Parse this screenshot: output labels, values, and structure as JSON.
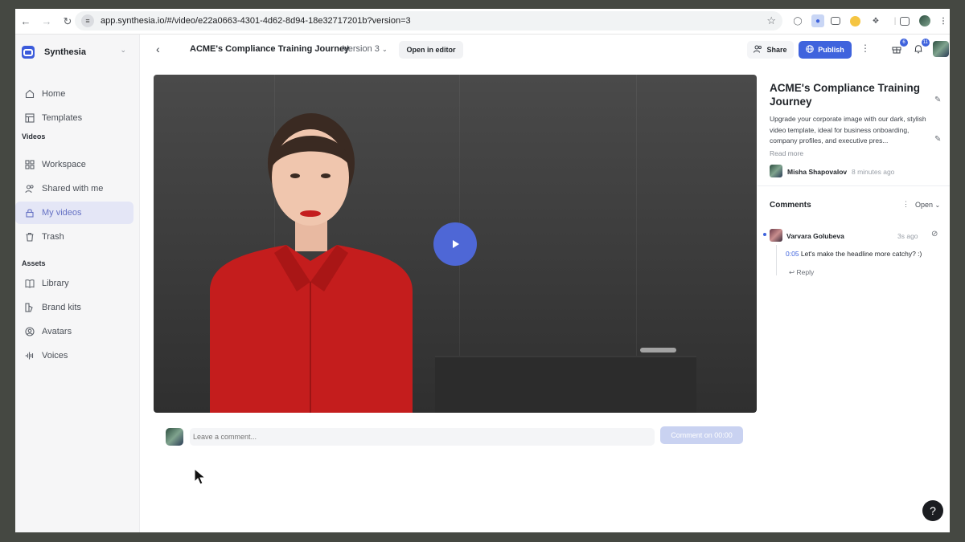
{
  "browser": {
    "url": "app.synthesia.io/#/video/e22a0663-4301-4d62-8d94-18e32717201b?version=3"
  },
  "sidebar": {
    "brand": "Synthesia",
    "items_top": [
      {
        "label": "Home",
        "icon": "home-icon"
      },
      {
        "label": "Templates",
        "icon": "templates-icon"
      }
    ],
    "videos_label": "Videos",
    "items_videos": [
      {
        "label": "Workspace",
        "icon": "workspace-icon"
      },
      {
        "label": "Shared with me",
        "icon": "shared-icon"
      },
      {
        "label": "My videos",
        "icon": "lock-icon",
        "active": true
      },
      {
        "label": "Trash",
        "icon": "trash-icon"
      }
    ],
    "assets_label": "Assets",
    "items_assets": [
      {
        "label": "Library",
        "icon": "book-icon"
      },
      {
        "label": "Brand kits",
        "icon": "brand-kit-icon"
      },
      {
        "label": "Avatars",
        "icon": "avatar-icon"
      },
      {
        "label": "Voices",
        "icon": "waveform-icon"
      }
    ]
  },
  "header": {
    "title": "ACME's Compliance Training Journey",
    "version": "Version 3",
    "open_editor": "Open in editor",
    "share": "Share",
    "publish": "Publish",
    "gift_badge": "6",
    "bell_badge": "11"
  },
  "comment_input": {
    "placeholder": "Leave a comment...",
    "button": "Comment on 00:00"
  },
  "details": {
    "title": "ACME's Compliance Training Journey",
    "description": "Upgrade your corporate image with our dark, stylish video template, ideal for business onboarding, company profiles, and executive pres...",
    "read_more": "Read more",
    "author": "Misha Shapovalov",
    "time": "8 minutes ago"
  },
  "comments": {
    "heading": "Comments",
    "filter": "Open",
    "items": [
      {
        "author": "Varvara Golubeva",
        "time": "3s ago",
        "timestamp": "0:05",
        "text": "Let's make the headline more catchy? :)",
        "reply": "Reply"
      }
    ]
  },
  "colors": {
    "accent": "#3f63dd",
    "active_nav_bg": "#e4e6f6",
    "blouse_red": "#c41d1d"
  }
}
